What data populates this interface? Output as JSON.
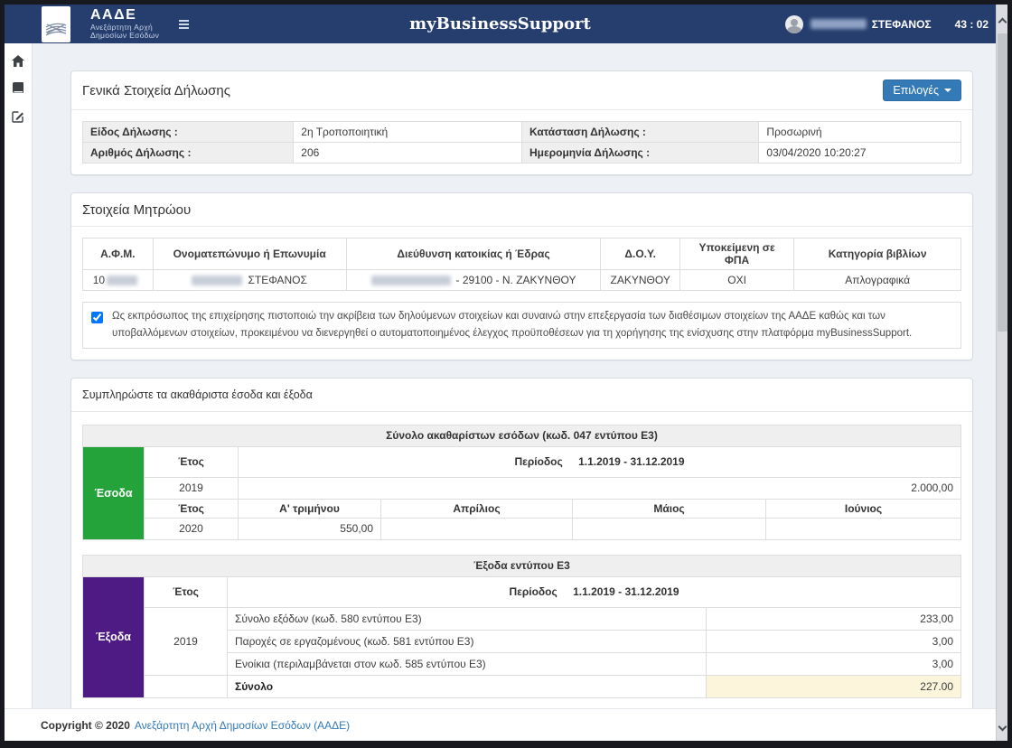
{
  "colors": {
    "navbar": "#253e6e",
    "accent": "#337ab7",
    "income_green": "#24a33b",
    "expense_purple": "#4e1a84",
    "total_highlight": "#fcf5dc"
  },
  "navbar": {
    "logo": {
      "title": "ΑΑΔΕ",
      "subtitle1": "Ανεξάρτητη Αρχή",
      "subtitle2": "Δημοσίων Εσόδων"
    },
    "app_title": "myBusinessSupport",
    "user": {
      "name_visible": "ΣΤΕΦΑΝΟΣ"
    },
    "timer": "43 : 02"
  },
  "sidebar": {
    "items": [
      {
        "icon": "home-icon"
      },
      {
        "icon": "book-icon"
      },
      {
        "icon": "edit-icon"
      }
    ]
  },
  "general_panel": {
    "title": "Γενικά Στοιχεία Δήλωσης",
    "options_button": "Επιλογές",
    "fields": [
      {
        "label": "Είδος Δήλωσης :",
        "value": "2η Τροποποιητική"
      },
      {
        "label": "Κατάσταση Δήλωσης :",
        "value": "Προσωρινή"
      },
      {
        "label": "Αριθμός Δήλωσης :",
        "value": "206"
      },
      {
        "label": "Ημερομηνία Δήλωσης :",
        "value": "03/04/2020 10:20:27"
      }
    ]
  },
  "registry_panel": {
    "title": "Στοιχεία Μητρώου",
    "columns": [
      "Α.Φ.Μ.",
      "Ονοματεπώνυμο ή Επωνυμία",
      "Διεύθυνση κατοικίας ή Έδρας",
      "Δ.Ο.Υ.",
      "Υποκείμενη σε ΦΠΑ",
      "Κατηγορία βιβλίων"
    ],
    "row": {
      "afm_prefix": "10",
      "name_visible": "ΣΤΕΦΑΝΟΣ",
      "address_visible": "- 29100 - Ν. ΖΑΚΥΝΘΟΥ",
      "doy": "ΖΑΚΥΝΘΟΥ",
      "vat": "ΟΧΙ",
      "books": "Απλογραφικά"
    },
    "consent_text": "Ως εκπρόσωπος της επιχείρησης πιστοποιώ την ακρίβεια των δηλούμενων στοιχείων και συναινώ στην επεξεργασία των διαθέσιμων στοιχείων της ΑΑΔΕ καθώς και των υποβαλλόμενων στοιχείων, προκειμένου να διενεργηθεί ο αυτοματοποιημένος έλεγχος προϋποθέσεων για τη χορήγησης της ενίσχυσης στην πλατφόρμα myBusinessSupport."
  },
  "income_expenses_panel": {
    "title": "Συμπληρώστε τα ακαθάριστα έσοδα και έξοδα",
    "income_table": {
      "header": "Σύνολο ακαθαρίστων εσόδων (κωδ. 047 εντύπου Ε3)",
      "side_label": "Έσοδα",
      "side_color": "#24a33b",
      "year_label": "Έτος",
      "period_label": "Περίοδος",
      "period_value": "1.1.2019 - 31.12.2019",
      "year1": "2019",
      "year1_total": "2.000,00",
      "month_columns": [
        "Α' τριμήνου",
        "Απρίλιος",
        "Μάιος",
        "Ιούνιος"
      ],
      "year2": "2020",
      "month_values": [
        "550,00",
        "",
        "",
        ""
      ]
    },
    "expenses_table": {
      "header": "Έξοδα εντύπου Ε3",
      "side_label": "Έξοδα",
      "side_color": "#4e1a84",
      "year_label": "Έτος",
      "period_label": "Περίοδος",
      "period_value": "1.1.2019 - 31.12.2019",
      "year": "2019",
      "rows": [
        {
          "label": "Σύνολο εξόδων (κωδ. 580 εντύπου Ε3)",
          "value": "233,00"
        },
        {
          "label": "Παροχές σε εργαζομένους (κωδ. 581 εντύπου Ε3)",
          "value": "3,00"
        },
        {
          "label": "Ενοίκια (περιλαμβάνεται στον κωδ. 585 εντύπου Ε3)",
          "value": "3,00"
        }
      ],
      "total_label": "Σύνολο",
      "total_value": "227.00"
    }
  },
  "footer": {
    "copyright": "Copyright © 2020",
    "link": "Ανεξάρτητη Αρχή Δημοσίων Εσόδων (ΑΑΔΕ)"
  }
}
